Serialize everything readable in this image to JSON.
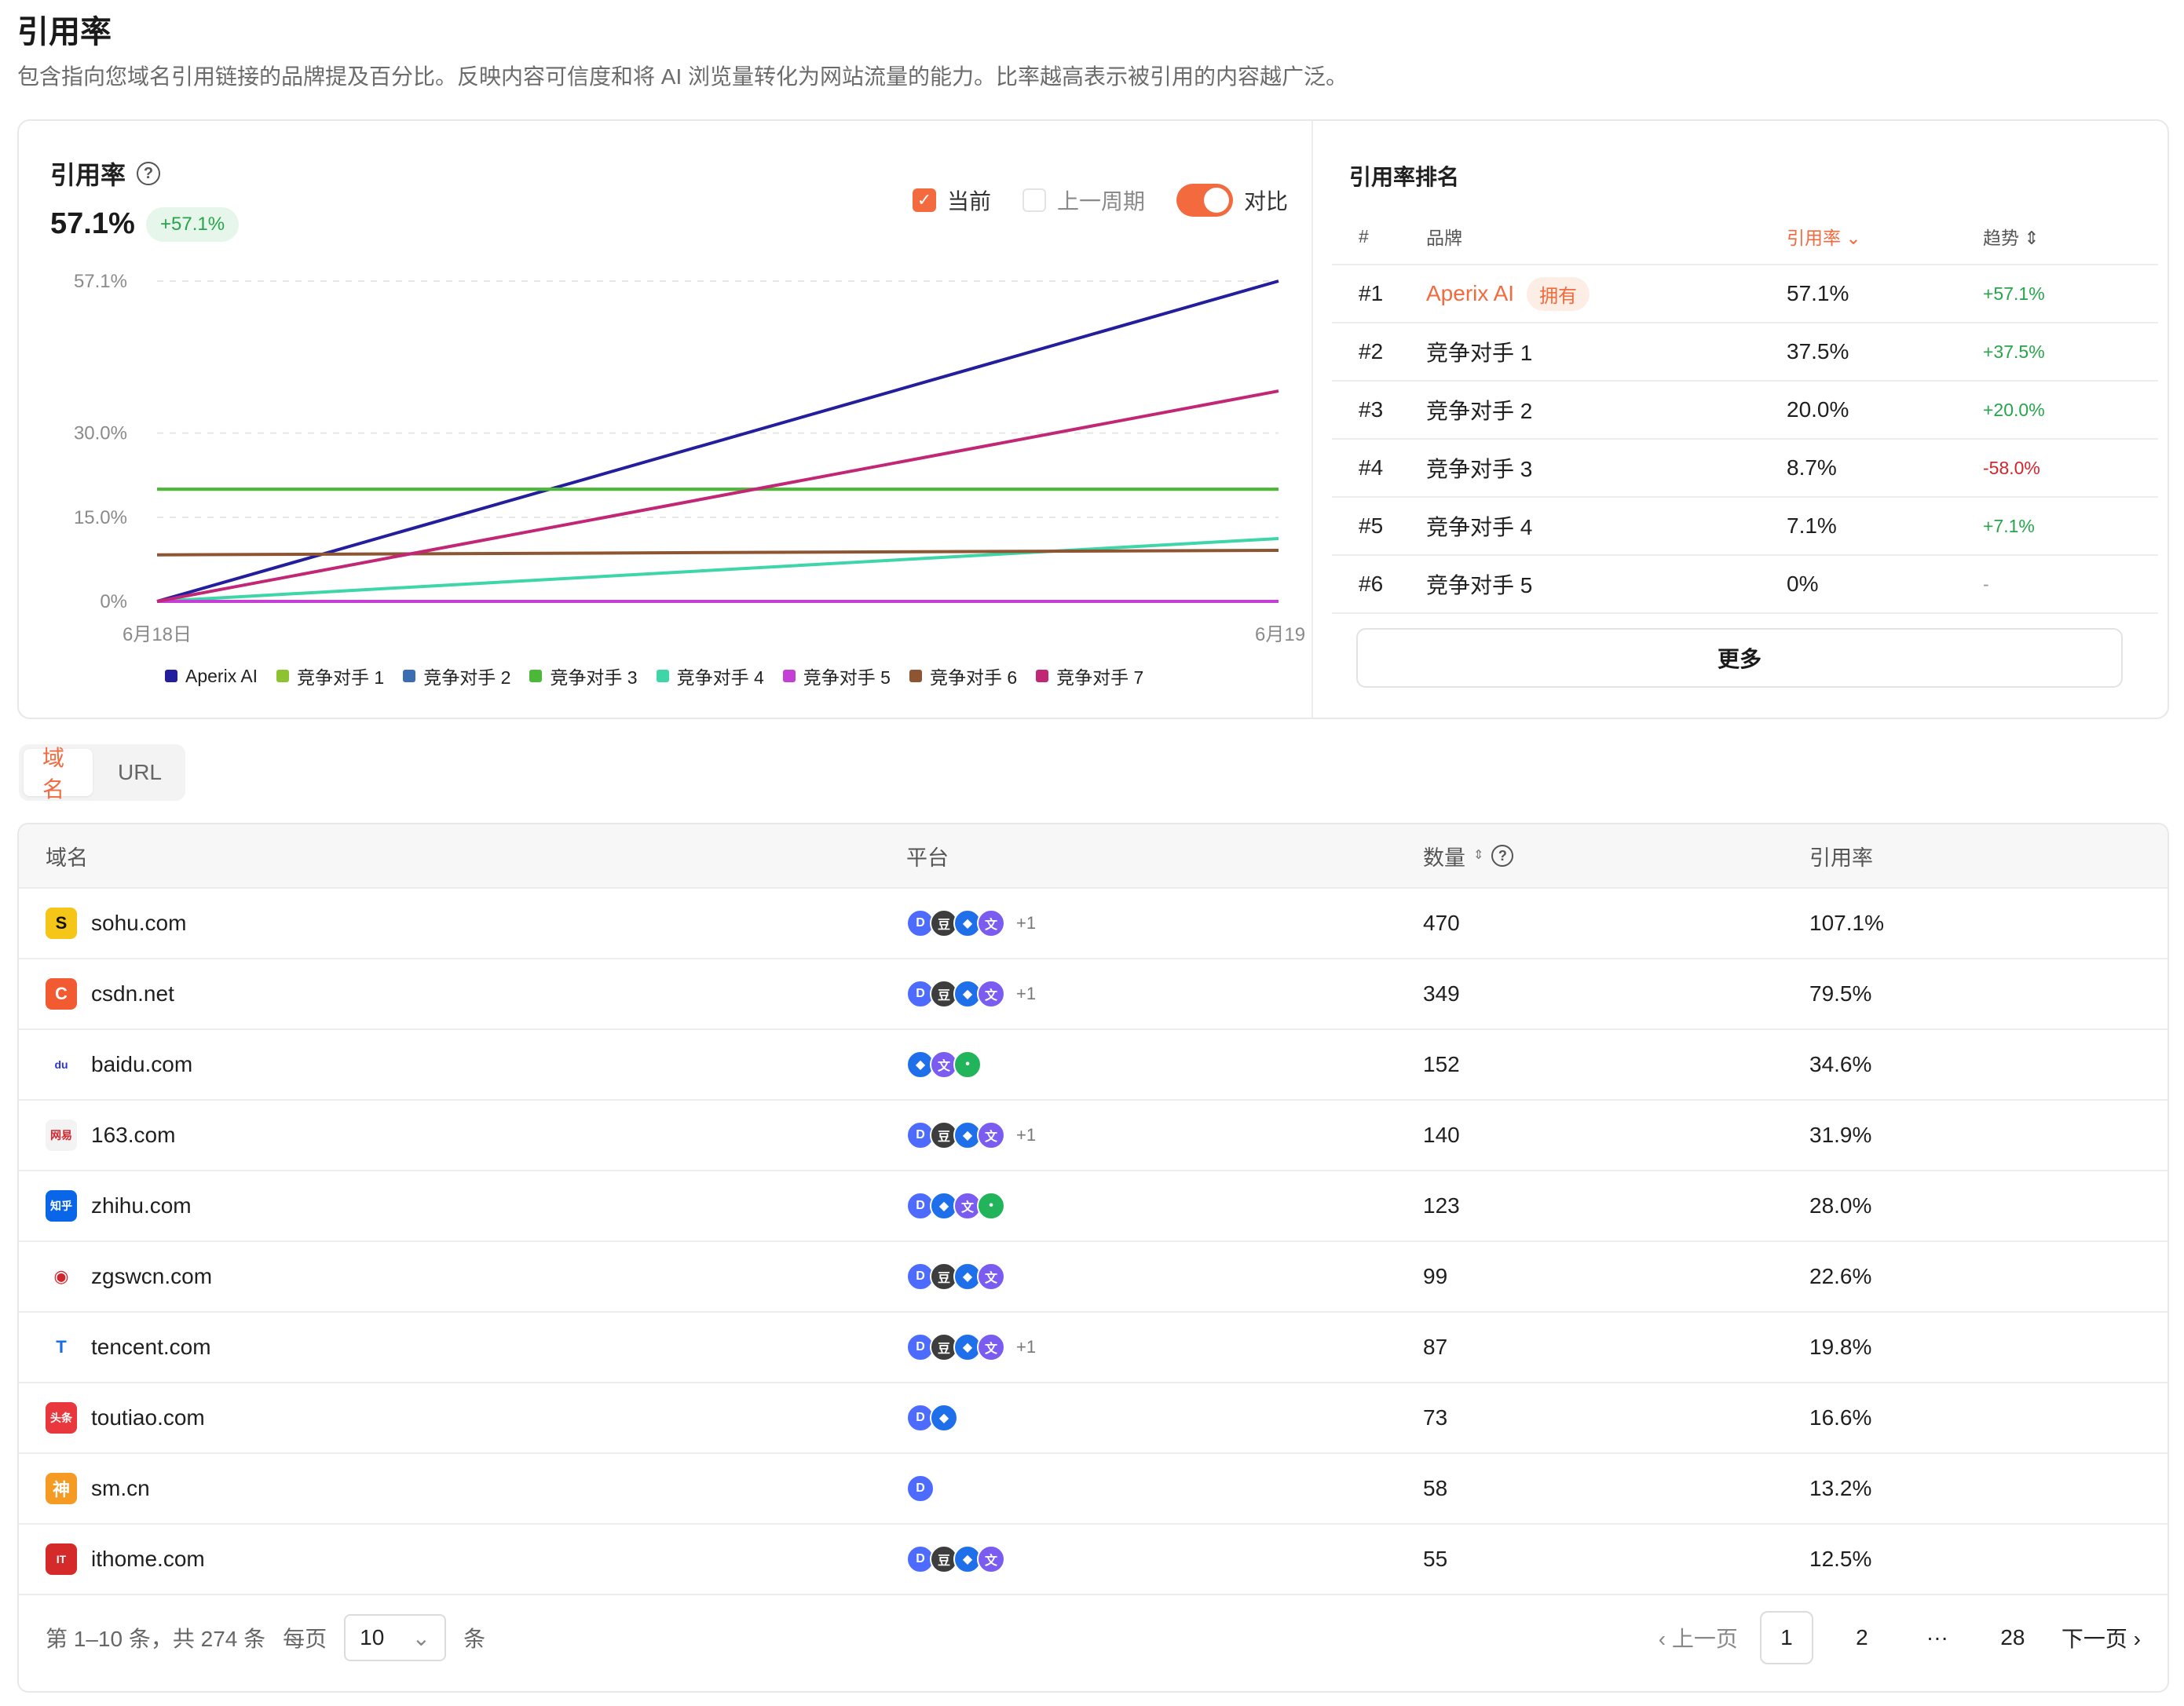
{
  "header": {
    "title": "引用率",
    "description": "包含指向您域名引用链接的品牌提及百分比。反映内容可信度和将 AI 浏览量转化为网站流量的能力。比率越高表示被引用的内容越广泛。"
  },
  "chart_panel": {
    "title": "引用率",
    "value": "57.1%",
    "delta": "+57.1%",
    "controls": {
      "current_label": "当前",
      "previous_label": "上一周期",
      "compare_label": "对比",
      "current_checked": true,
      "previous_checked": false,
      "compare_on": true
    }
  },
  "chart_data": {
    "type": "line",
    "x": [
      "6月18日",
      "6月19"
    ],
    "y_ticks": [
      "57.1%",
      "30.0%",
      "15.0%",
      "0%"
    ],
    "y_tick_values": [
      57.1,
      30.0,
      15.0,
      0
    ],
    "ylim": [
      0,
      57.1
    ],
    "grid": true,
    "series": [
      {
        "name": "Aperix AI",
        "color": "#231f9c",
        "values": [
          0,
          57.1
        ]
      },
      {
        "name": "竞争对手 1",
        "color": "#8fc231",
        "values": [
          20.0,
          20.0
        ]
      },
      {
        "name": "竞争对手 2",
        "color": "#3b6db3",
        "values": [
          0,
          0
        ]
      },
      {
        "name": "竞争对手 3",
        "color": "#4cb83a",
        "values": [
          20.0,
          20.0
        ]
      },
      {
        "name": "竞争对手 4",
        "color": "#3ed6a8",
        "values": [
          0,
          11.2
        ]
      },
      {
        "name": "竞争对手 5",
        "color": "#c43fd6",
        "values": [
          0,
          0
        ]
      },
      {
        "name": "竞争对手 6",
        "color": "#8d5532",
        "values": [
          8.3,
          9.1
        ]
      },
      {
        "name": "竞争对手 7",
        "color": "#c12775",
        "values": [
          0,
          37.5
        ]
      }
    ]
  },
  "ranking": {
    "title": "引用率排名",
    "columns": {
      "pos": "#",
      "brand": "品牌",
      "rate": "引用率",
      "trend": "趋势"
    },
    "rows": [
      {
        "pos": "#1",
        "brand": "Aperix AI",
        "badge": "拥有",
        "rate": "57.1%",
        "trend": "+57.1%"
      },
      {
        "pos": "#2",
        "brand": "竞争对手 1",
        "badge": "",
        "rate": "37.5%",
        "trend": "+37.5%"
      },
      {
        "pos": "#3",
        "brand": "竞争对手 2",
        "badge": "",
        "rate": "20.0%",
        "trend": "+20.0%"
      },
      {
        "pos": "#4",
        "brand": "竞争对手 3",
        "badge": "",
        "rate": "8.7%",
        "trend": "-58.0%"
      },
      {
        "pos": "#5",
        "brand": "竞争对手 4",
        "badge": "",
        "rate": "7.1%",
        "trend": "+7.1%"
      },
      {
        "pos": "#6",
        "brand": "竞争对手 5",
        "badge": "",
        "rate": "0%",
        "trend": "-"
      }
    ],
    "more_label": "更多"
  },
  "tabs": [
    {
      "label": "域名",
      "active": true
    },
    {
      "label": "URL",
      "active": false
    }
  ],
  "domain_table": {
    "columns": {
      "domain": "域名",
      "platform": "平台",
      "count": "数量",
      "rate": "引用率"
    },
    "rows": [
      {
        "domain": "sohu.com",
        "icon": "sohu-icon",
        "platforms": [
          "deepseek",
          "doubao",
          "tongyi",
          "kimi"
        ],
        "extra": "+1",
        "count": "470",
        "rate": "107.1%"
      },
      {
        "domain": "csdn.net",
        "icon": "csdn-icon",
        "platforms": [
          "deepseek",
          "doubao",
          "tongyi",
          "kimi"
        ],
        "extra": "+1",
        "count": "349",
        "rate": "79.5%"
      },
      {
        "domain": "baidu.com",
        "icon": "baidu-icon",
        "platforms": [
          "tongyi",
          "kimi",
          "wenxin"
        ],
        "extra": "",
        "count": "152",
        "rate": "34.6%"
      },
      {
        "domain": "163.com",
        "icon": "netease-icon",
        "platforms": [
          "deepseek",
          "doubao",
          "tongyi",
          "kimi"
        ],
        "extra": "+1",
        "count": "140",
        "rate": "31.9%"
      },
      {
        "domain": "zhihu.com",
        "icon": "zhihu-icon",
        "platforms": [
          "deepseek",
          "tongyi",
          "kimi",
          "wenxin"
        ],
        "extra": "",
        "count": "123",
        "rate": "28.0%"
      },
      {
        "domain": "zgswcn.com",
        "icon": "zgswcn-icon",
        "platforms": [
          "deepseek",
          "doubao",
          "tongyi",
          "kimi"
        ],
        "extra": "",
        "count": "99",
        "rate": "22.6%"
      },
      {
        "domain": "tencent.com",
        "icon": "tencent-icon",
        "platforms": [
          "deepseek",
          "doubao",
          "tongyi",
          "kimi"
        ],
        "extra": "+1",
        "count": "87",
        "rate": "19.8%"
      },
      {
        "domain": "toutiao.com",
        "icon": "toutiao-icon",
        "platforms": [
          "deepseek",
          "tongyi"
        ],
        "extra": "",
        "count": "73",
        "rate": "16.6%"
      },
      {
        "domain": "sm.cn",
        "icon": "shenma-icon",
        "platforms": [
          "deepseek"
        ],
        "extra": "",
        "count": "58",
        "rate": "13.2%"
      },
      {
        "domain": "ithome.com",
        "icon": "ithome-icon",
        "platforms": [
          "deepseek",
          "doubao",
          "tongyi",
          "kimi"
        ],
        "extra": "",
        "count": "55",
        "rate": "12.5%"
      }
    ]
  },
  "pagination": {
    "summary": "第 1–10 条，共 274 条",
    "per_page_label": "每页",
    "per_page_value": "10",
    "per_page_unit": "条",
    "prev_label": "上一页",
    "pages": [
      "1",
      "2",
      "···",
      "28"
    ],
    "current_page": "1",
    "next_label": "下一页"
  },
  "colors": {
    "accent": "#f26a3d",
    "positive": "#27a54a",
    "negative": "#d0262d"
  }
}
